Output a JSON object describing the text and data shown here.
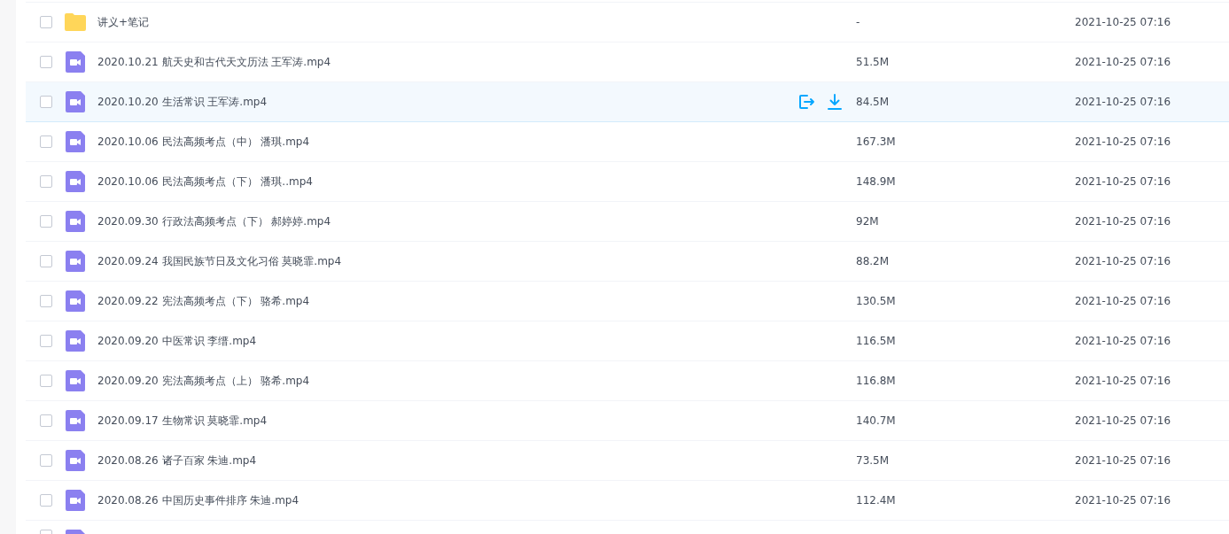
{
  "rows": [
    {
      "kind": "folder",
      "name": "讲义+笔记",
      "size": "-",
      "modified": "2021-10-25 07:16",
      "checked": false,
      "highlighted": false
    },
    {
      "kind": "video",
      "name": "2020.10.21 航天史和古代天文历法 王军涛.mp4",
      "size": "51.5M",
      "modified": "2021-10-25 07:16",
      "checked": false,
      "highlighted": false
    },
    {
      "kind": "video",
      "name": "2020.10.20 生活常识 王军涛.mp4",
      "size": "84.5M",
      "modified": "2021-10-25 07:16",
      "checked": false,
      "highlighted": true
    },
    {
      "kind": "video",
      "name": "2020.10.06 民法高频考点（中） 潘琪.mp4",
      "size": "167.3M",
      "modified": "2021-10-25 07:16",
      "checked": false,
      "highlighted": false
    },
    {
      "kind": "video",
      "name": "2020.10.06 民法高频考点（下） 潘琪..mp4",
      "size": "148.9M",
      "modified": "2021-10-25 07:16",
      "checked": false,
      "highlighted": false
    },
    {
      "kind": "video",
      "name": "2020.09.30 行政法高频考点（下） 郝婷婷.mp4",
      "size": "92M",
      "modified": "2021-10-25 07:16",
      "checked": false,
      "highlighted": false
    },
    {
      "kind": "video",
      "name": "2020.09.24 我国民族节日及文化习俗 莫晓霏.mp4",
      "size": "88.2M",
      "modified": "2021-10-25 07:16",
      "checked": false,
      "highlighted": false
    },
    {
      "kind": "video",
      "name": "2020.09.22 宪法高频考点（下） 骆希.mp4",
      "size": "130.5M",
      "modified": "2021-10-25 07:16",
      "checked": false,
      "highlighted": false
    },
    {
      "kind": "video",
      "name": "2020.09.20 中医常识 李缙.mp4",
      "size": "116.5M",
      "modified": "2021-10-25 07:16",
      "checked": false,
      "highlighted": false
    },
    {
      "kind": "video",
      "name": "2020.09.20 宪法高频考点（上） 骆希.mp4",
      "size": "116.8M",
      "modified": "2021-10-25 07:16",
      "checked": false,
      "highlighted": false
    },
    {
      "kind": "video",
      "name": "2020.09.17 生物常识 莫晓霏.mp4",
      "size": "140.7M",
      "modified": "2021-10-25 07:16",
      "checked": false,
      "highlighted": false
    },
    {
      "kind": "video",
      "name": "2020.08.26 诸子百家 朱迪.mp4",
      "size": "73.5M",
      "modified": "2021-10-25 07:16",
      "checked": false,
      "highlighted": false
    },
    {
      "kind": "video",
      "name": "2020.08.26 中国历史事件排序 朱迪.mp4",
      "size": "112.4M",
      "modified": "2021-10-25 07:16",
      "checked": false,
      "highlighted": false
    }
  ],
  "partial_row": {
    "kind": "video",
    "checked": false
  }
}
